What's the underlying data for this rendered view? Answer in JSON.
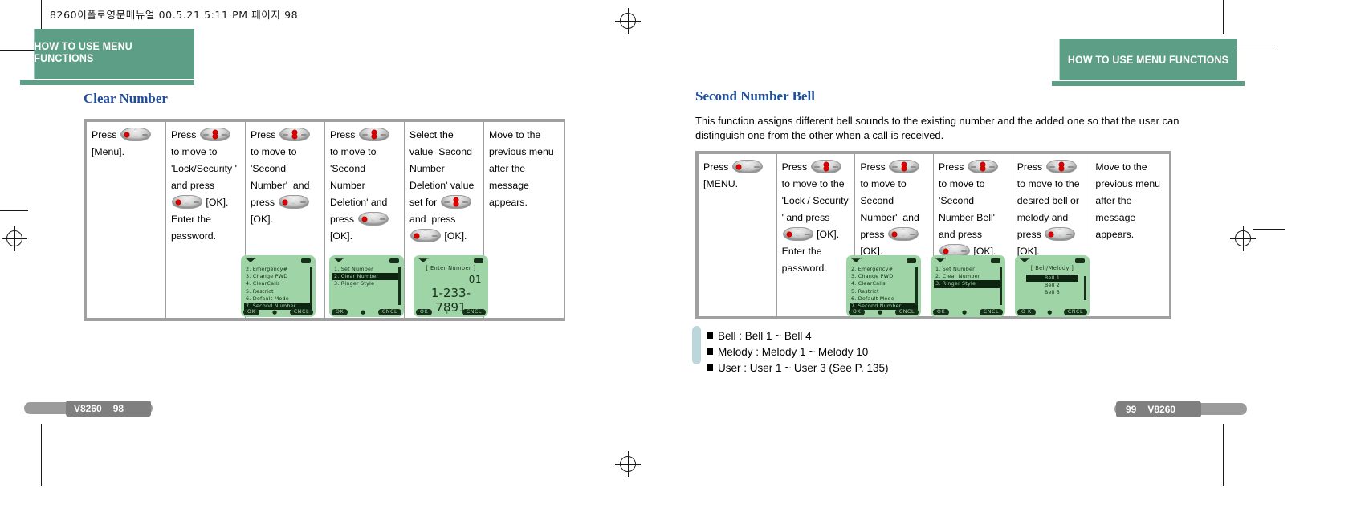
{
  "print_header": "8260이폴로영문메뉴얼   00.5.21 5:11 PM 페이지 98",
  "colors": {
    "banner_green": "#5d9e87",
    "heading_blue": "#1f4e9c",
    "lcd_green": "#9fd4a7",
    "lcd_dark": "#16301a",
    "table_border": "#a0a0a0",
    "key_red": "#e00000",
    "note_bar": "#bcd7dc"
  },
  "left_page": {
    "banner": "HOW TO USE MENU FUNCTIONS",
    "title": "Clear Number",
    "steps": [
      {
        "parts": [
          "Press ",
          "KEY_OK",
          " [Menu]."
        ]
      },
      {
        "parts": [
          "Press ",
          "KEY_UPDN",
          " to move to  'Lock/Security ' and press ",
          "KEY_OK",
          " [OK]. Enter the password."
        ]
      },
      {
        "parts": [
          "Press ",
          "KEY_UPDN",
          " to move to  'Second Number'  and press ",
          "KEY_OK",
          " [OK]."
        ]
      },
      {
        "parts": [
          "Press ",
          "KEY_UPDN",
          " to move to 'Second Number Deletion' and press ",
          "KEY_OK",
          " [OK]."
        ]
      },
      {
        "parts": [
          "Select the value  Second Number Deletion' value set for ",
          "KEY_UPDN",
          " and  press ",
          "KEY_OK",
          " [OK]."
        ]
      },
      {
        "parts": [
          "Move to the previous menu after the message appears."
        ]
      }
    ],
    "screens": [
      {
        "name": "security-menu-screen",
        "title": null,
        "items": [
          {
            "label": "2.  Emergency#",
            "selected": false
          },
          {
            "label": "3.  Change PWD",
            "selected": false
          },
          {
            "label": "4.  ClearCalls",
            "selected": false
          },
          {
            "label": "5.  Restrict",
            "selected": false
          },
          {
            "label": "6.  Default  Mode",
            "selected": false
          },
          {
            "label": "7.  Second  Number",
            "selected": true
          }
        ],
        "softkey_left": "OK",
        "softkey_right": "CNCL"
      },
      {
        "name": "second-number-menu-screen",
        "title": null,
        "items": [
          {
            "label": "1.  Set Number",
            "selected": false
          },
          {
            "label": "2.  Clear Number",
            "selected": true
          },
          {
            "label": "3.  Ringer Style",
            "selected": false
          }
        ],
        "softkey_left": "OK",
        "softkey_right": "CNCL"
      },
      {
        "name": "enter-number-screen",
        "title": "[ Enter  Number  ]",
        "value_small": "01",
        "value_large": "1-233-7891",
        "softkey_left": "OK",
        "softkey_mid": "f",
        "softkey_right": "CNCL"
      }
    ],
    "footer": {
      "model": "V8260",
      "page": "98"
    }
  },
  "right_page": {
    "banner": "HOW TO USE MENU FUNCTIONS",
    "title": "Second Number Bell",
    "intro": "This function assigns different bell sounds to the existing number and the added one so that the user can distinguish one from the other when a call is received.",
    "steps": [
      {
        "parts": [
          "Press ",
          "KEY_OK",
          " [MENU."
        ]
      },
      {
        "parts": [
          "Press ",
          "KEY_UPDN",
          " to move to the  'Lock / Security ' and press ",
          "KEY_OK",
          " [OK]. Enter the password."
        ]
      },
      {
        "parts": [
          "Press ",
          "KEY_UPDN",
          " to move to  Second Number'  and press ",
          "KEY_OK",
          " [OK]."
        ]
      },
      {
        "parts": [
          "Press ",
          "KEY_UPDN",
          " to move to  'Second Number Bell'  and press ",
          "KEY_OK",
          " [OK]."
        ]
      },
      {
        "parts": [
          "Press ",
          "KEY_UPDN",
          " to move to the desired bell or melody and press ",
          "KEY_OK",
          " [OK]."
        ]
      },
      {
        "parts": [
          "Move to the previous menu after the message appears."
        ]
      }
    ],
    "screens": [
      {
        "name": "security-menu-screen",
        "title": null,
        "items": [
          {
            "label": "2.  Emergency#",
            "selected": false
          },
          {
            "label": "3.  Change PWD",
            "selected": false
          },
          {
            "label": "4.  ClearCalls",
            "selected": false
          },
          {
            "label": "5.  Restrict",
            "selected": false
          },
          {
            "label": "6.  Default  Mode",
            "selected": false
          },
          {
            "label": "7.  Second  Number",
            "selected": true
          }
        ],
        "softkey_left": "OK",
        "softkey_right": "CNCL"
      },
      {
        "name": "second-number-menu-screen",
        "title": null,
        "items": [
          {
            "label": "1.  Set Number",
            "selected": false
          },
          {
            "label": "2.  Clear Number",
            "selected": false
          },
          {
            "label": "3.  Ringer Style",
            "selected": true
          }
        ],
        "softkey_left": "OK",
        "softkey_right": "CNCL"
      },
      {
        "name": "bell-melody-screen",
        "title": "[ Bell/Melody ]",
        "items": [
          {
            "label": "Bell 1",
            "selected": true
          },
          {
            "label": "Bell 2",
            "selected": false
          },
          {
            "label": "Bell 3",
            "selected": false
          }
        ],
        "softkey_left": "O K",
        "softkey_right": "CNCL"
      }
    ],
    "notes": [
      "Bell : Bell 1 ~ Bell 4",
      "Melody : Melody 1 ~ Melody 10",
      "User : User 1 ~ User 3 (See P. 135)"
    ],
    "footer": {
      "model": "V8260",
      "page": "99"
    }
  }
}
